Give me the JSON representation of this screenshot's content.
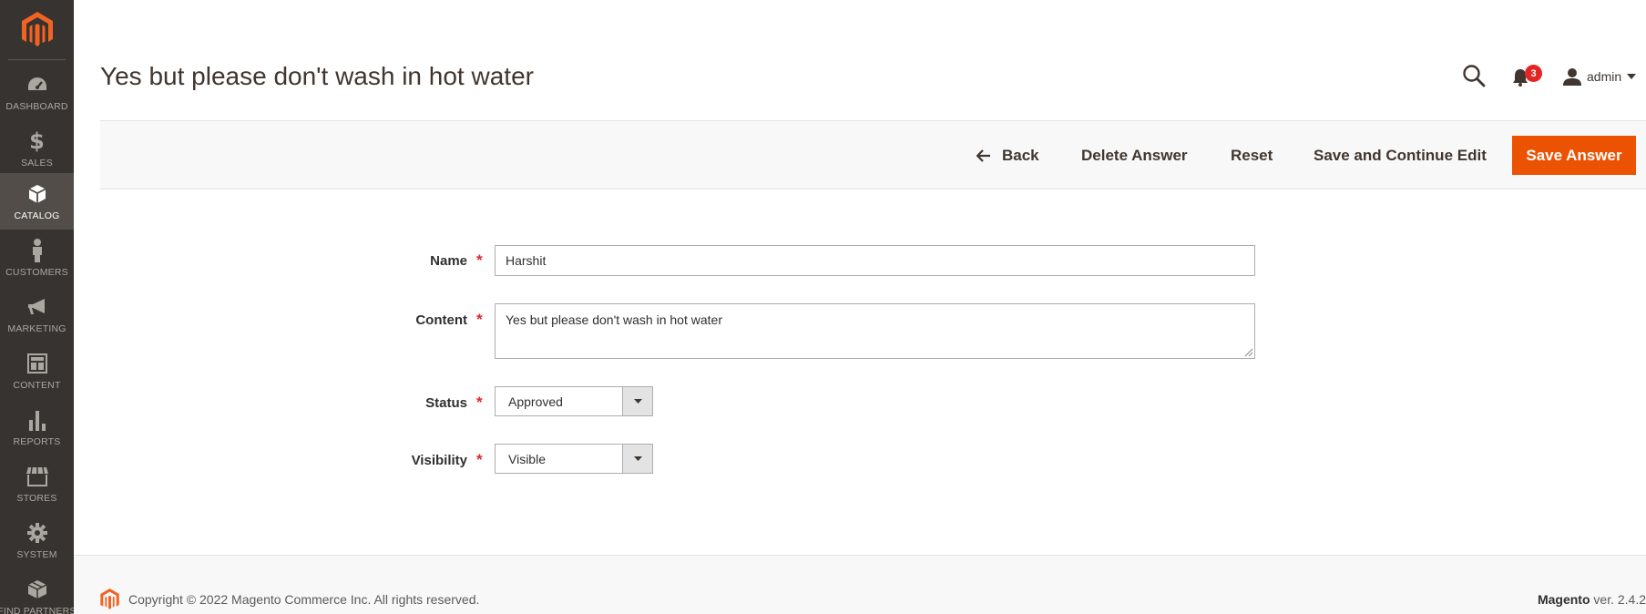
{
  "sidebar": {
    "items": [
      {
        "label": "DASHBOARD",
        "icon": "dashboard-icon"
      },
      {
        "label": "SALES",
        "icon": "dollar-icon"
      },
      {
        "label": "CATALOG",
        "icon": "box-icon",
        "active": true
      },
      {
        "label": "CUSTOMERS",
        "icon": "person-icon"
      },
      {
        "label": "MARKETING",
        "icon": "megaphone-icon"
      },
      {
        "label": "CONTENT",
        "icon": "layout-icon"
      },
      {
        "label": "REPORTS",
        "icon": "bar-chart-icon"
      },
      {
        "label": "STORES",
        "icon": "storefront-icon"
      },
      {
        "label": "SYSTEM",
        "icon": "gear-icon"
      },
      {
        "label": "FIND PARTNERS",
        "icon": "extensions-icon"
      }
    ]
  },
  "header": {
    "title": "Yes but please don't wash in hot water",
    "notifications_count": "3",
    "user_name": "admin"
  },
  "actions": {
    "back": "Back",
    "delete": "Delete Answer",
    "reset": "Reset",
    "save_continue": "Save and Continue Edit",
    "save": "Save Answer"
  },
  "form": {
    "name": {
      "label": "Name",
      "value": "Harshit"
    },
    "content": {
      "label": "Content",
      "value": "Yes but please don't wash in hot water"
    },
    "status": {
      "label": "Status",
      "value": "Approved"
    },
    "visibility": {
      "label": "Visibility",
      "value": "Visible"
    }
  },
  "footer": {
    "copyright": "Copyright © 2022 Magento Commerce Inc. All rights reserved.",
    "brand": "Magento",
    "version": " ver. 2.4.2"
  },
  "colors": {
    "accent": "#eb5202",
    "sidebar_bg": "#373330",
    "badge": "#e22626"
  }
}
